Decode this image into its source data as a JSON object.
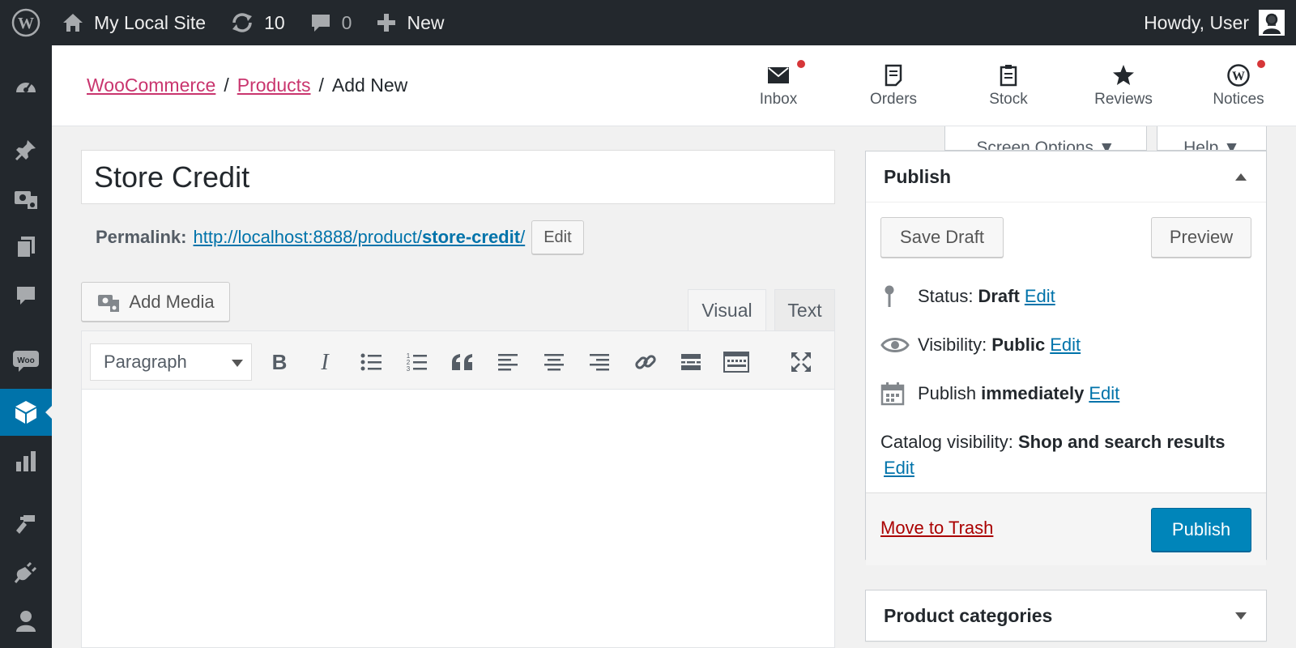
{
  "adminbar": {
    "site_name": "My Local Site",
    "updates_count": "10",
    "comments_count": "0",
    "new_label": "New",
    "howdy": "Howdy, User"
  },
  "breadcrumb": {
    "woocommerce": "WooCommerce",
    "products": "Products",
    "sep": "/",
    "current": "Add New"
  },
  "header_nav": [
    {
      "label": "Inbox",
      "icon": "envelope-icon",
      "has_dot": true
    },
    {
      "label": "Orders",
      "icon": "orders-icon",
      "has_dot": false
    },
    {
      "label": "Stock",
      "icon": "clipboard-icon",
      "has_dot": false
    },
    {
      "label": "Reviews",
      "icon": "star-icon",
      "has_dot": false
    },
    {
      "label": "Notices",
      "icon": "wordpress-icon",
      "has_dot": true
    }
  ],
  "screen_tabs": {
    "screen_options": "Screen Options ▼",
    "help": "Help ▼"
  },
  "post": {
    "title": "Store Credit",
    "permalink_label": "Permalink:",
    "permalink_base": "http://localhost:8888/product/",
    "permalink_slug": "store-credit",
    "permalink_trail": "/",
    "permalink_edit": "Edit"
  },
  "editor": {
    "add_media": "Add Media",
    "tab_visual": "Visual",
    "tab_text": "Text",
    "format": "Paragraph"
  },
  "publish": {
    "title": "Publish",
    "save_draft": "Save Draft",
    "preview": "Preview",
    "status_label": "Status:",
    "status_value": "Draft",
    "visibility_label": "Visibility:",
    "visibility_value": "Public",
    "publish_label": "Publish",
    "publish_value": "immediately",
    "edit": "Edit",
    "catalog_label": "Catalog visibility:",
    "catalog_value": "Shop and search results",
    "trash": "Move to Trash",
    "publish_button": "Publish"
  },
  "categories": {
    "title": "Product categories"
  },
  "colors": {
    "adminbar_bg": "#23282d",
    "active_menu": "#0073aa",
    "woo_link": "#c9356e",
    "link": "#0073aa",
    "primary": "#0085ba",
    "trash": "#a00",
    "notification_dot": "#d63638"
  }
}
